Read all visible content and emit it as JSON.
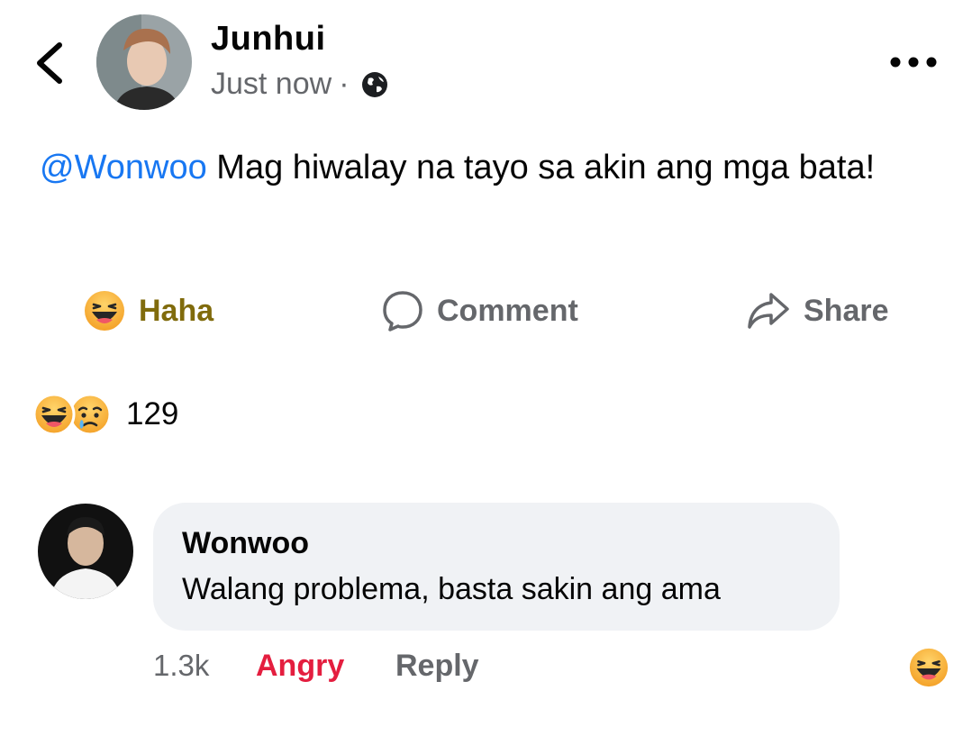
{
  "post": {
    "author": "Junhui",
    "time": "Just now",
    "separator": "·",
    "audience_icon": "globe-icon",
    "mention": "@Wonwoo",
    "text": " Mag hiwalay na tayo sa akin ang mga bata!"
  },
  "actions": {
    "reaction_label": "Haha",
    "comment_label": "Comment",
    "share_label": "Share"
  },
  "reactions": {
    "icons": [
      "haha-emoji-icon",
      "sad-emoji-icon"
    ],
    "count": "129"
  },
  "comment": {
    "author": "Wonwoo",
    "text": "Walang problema, basta sakin ang ama",
    "time": "1.3k",
    "reaction_label": "Angry",
    "reply_label": "Reply",
    "reaction_icon": "haha-emoji-icon"
  },
  "colors": {
    "mention": "#1877f2",
    "haha_label": "#806b0c",
    "angry_label": "#e41e3f",
    "secondary_text": "#65676b",
    "bubble": "#f0f2f5"
  }
}
